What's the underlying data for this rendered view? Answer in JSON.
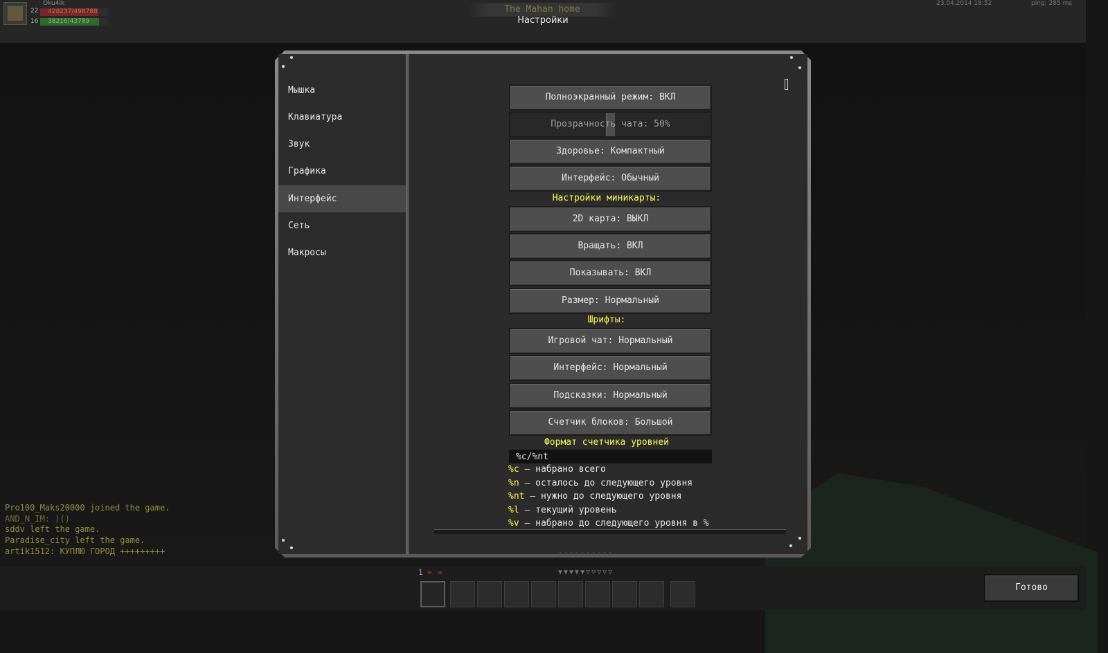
{
  "hud_top": {
    "player_name": "Oku4ik",
    "stat1": {
      "level": "22",
      "text": "428237/498788",
      "fraction": 0.86,
      "color": "#7a2626"
    },
    "stat2": {
      "level": "16",
      "text": "38216/43789",
      "fraction": 0.87,
      "color": "#2f6a2a"
    },
    "location": "The Mahan home",
    "screen_title": "Настройки",
    "datetime": "23.04.2014 18:52",
    "ping": "ping: 285 ms"
  },
  "sidebar": {
    "items": [
      {
        "label": "Мышка",
        "active": false
      },
      {
        "label": "Клавиатура",
        "active": false
      },
      {
        "label": "Звук",
        "active": false
      },
      {
        "label": "Графика",
        "active": false
      },
      {
        "label": "Интерфейс",
        "active": true
      },
      {
        "label": "Сеть",
        "active": false
      },
      {
        "label": "Макросы",
        "active": false
      }
    ]
  },
  "settings": {
    "fullscreen": "Полноэкранный режим: ВКЛ",
    "chat_opacity": {
      "label": "Прозрачность чата: 50%",
      "value": 0.5
    },
    "health": "Здоровье: Компактный",
    "interface": "Интерфейс: Обычный",
    "minimap_header": "Настройки миникарты:",
    "map_2d": "2D карта: ВЫКЛ",
    "rotate": "Вращать: ВКЛ",
    "show": "Показывать: ВКЛ",
    "size": "Размер: Нормальный",
    "fonts_header": "Шрифты:",
    "game_chat": "Игровой чат: Нормальный",
    "interface_font": "Интерфейс: Нормальный",
    "tooltips": "Подсказки: Нормальный",
    "block_counter": "Счетчик блоков: Большой",
    "level_format_header": "Формат счетчика уровней",
    "level_format_value": "%c/%nt",
    "legend": [
      {
        "code": "%c",
        "text": " – набрано всего"
      },
      {
        "code": "%n",
        "text": " – осталось до следующего уровня"
      },
      {
        "code": "%nt",
        "text": " – нужно до следующего уровня"
      },
      {
        "code": "%l",
        "text": " – текущий уровень"
      },
      {
        "code": "%v",
        "text": " – набрано до следующего уровня в %"
      }
    ]
  },
  "chat": [
    {
      "text": "Pro100_Maks20000 joined the game.",
      "color": "#8f8f3f"
    },
    {
      "text": "AND_N_IM: )()",
      "color": "#6e6e3a"
    },
    {
      "text": "sddv left the game.",
      "color": "#8f8f3f"
    },
    {
      "text": "Paradise_city left the game.",
      "color": "#8f8f3f"
    },
    {
      "text": "artik1512: КУПЛЮ ГОРОД +++++++++",
      "color": "#8f8f3f"
    }
  ],
  "hud_bottom": {
    "level": "1",
    "hotbar_selected": 0
  },
  "done_label": "Готово"
}
